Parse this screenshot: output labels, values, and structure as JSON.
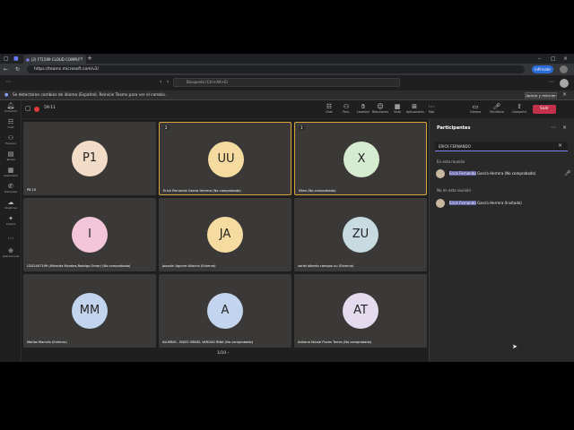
{
  "browser": {
    "tab_title": "(2) FT1599 CLOUD COMPUTI",
    "url": "https://teams.microsoft.com/v2/",
    "inprivate": "InPrivate"
  },
  "teams": {
    "search_placeholder": "Búsqueda (Ctrl+Alt+E)"
  },
  "banner": {
    "text": "Se detectaron cambios de idioma (Español). Reinicie Teams para ver el cambio.",
    "button": "Aplicar y reiniciar"
  },
  "rail": {
    "items": [
      {
        "icon": "bell-icon",
        "label": "Actividad"
      },
      {
        "icon": "chat-icon",
        "label": "Chat"
      },
      {
        "icon": "teams-icon",
        "label": "Equipos"
      },
      {
        "icon": "assignments-icon",
        "label": "Tareas"
      },
      {
        "icon": "calendar-icon",
        "label": "Calendario"
      },
      {
        "icon": "calls-icon",
        "label": "Llamadas"
      },
      {
        "icon": "onedrive-icon",
        "label": "OneDrive"
      },
      {
        "icon": "copilot-icon",
        "label": "Copilot"
      },
      {
        "icon": "more-icon",
        "label": ""
      },
      {
        "icon": "apps-icon",
        "label": "Aplicaciones"
      }
    ]
  },
  "meeting": {
    "time": "59:11",
    "toolbar": [
      {
        "icon": "chat-icon",
        "label": "Chat"
      },
      {
        "icon": "people-icon",
        "label": "Pers."
      },
      {
        "icon": "raise-hand-icon",
        "label": "Levantar"
      },
      {
        "icon": "react-icon",
        "label": "Reacciones"
      },
      {
        "icon": "view-icon",
        "label": "Vista"
      },
      {
        "icon": "apps-icon",
        "label": "Aplicaciones"
      },
      {
        "icon": "more-icon",
        "label": "Más"
      },
      {
        "icon": "camera-icon",
        "label": "Cámara"
      },
      {
        "icon": "mic-icon",
        "label": "Micrófono"
      },
      {
        "icon": "share-icon",
        "label": "Compartir"
      }
    ],
    "leave": "Salir"
  },
  "tiles": [
    {
      "initials": "P1",
      "name": "P6 10",
      "color": "#f2dcc8",
      "badge": ""
    },
    {
      "initials": "UU",
      "name": "Erick Fernando García Herrera (No comprobado)",
      "color": "#f6dba0",
      "badge": "2",
      "active": true
    },
    {
      "initials": "X",
      "name": "XIlan (No comprobado)",
      "color": "#d6ecd0",
      "badge": "1",
      "active": true
    },
    {
      "initials": "I",
      "name": "U202407199 (Miranda Morales,Rodrigo Omar) (No comprobado)",
      "color": "#f2c6d8",
      "badge": ""
    },
    {
      "initials": "JA",
      "name": "Joaquín Aguirre Aliocha (Externo)",
      "color": "#f6dba0",
      "badge": ""
    },
    {
      "initials": "ZU",
      "name": "zariel alberto campos uu (Externo)",
      "color": "#c8dbe0",
      "badge": ""
    },
    {
      "initials": "MM",
      "name": "Matías Marrufo (Externo)",
      "color": "#c3d4ee",
      "badge": ""
    },
    {
      "initials": "A",
      "name": "ALUMNO - ENZO ISRAEL VARGAS RINA (No comprobado)",
      "color": "#c3d4ee",
      "badge": ""
    },
    {
      "initials": "AT",
      "name": "Adriana Nicole Flores Torres (No comprobado)",
      "color": "#e4dcee",
      "badge": ""
    }
  ],
  "pager": "1/10",
  "participants": {
    "title": "Participantes",
    "search_value": "ERICK FERNANDO",
    "in_meeting_label": "En esta reunión",
    "not_in_meeting_label": "No en esta reunión",
    "in_meeting": [
      {
        "highlight": "Erick Fernando",
        "rest": " García Herrera (No comprobado)",
        "initials": "EF"
      }
    ],
    "not_in_meeting": [
      {
        "highlight": "Erick Fernando",
        "rest": " García Herrera (Invitado)",
        "initials": "EF"
      }
    ]
  }
}
